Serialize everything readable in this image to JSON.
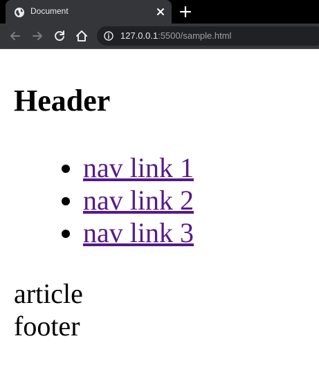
{
  "browser": {
    "tab": {
      "title": "Document",
      "favicon": "globe-icon",
      "close_icon": "close-icon"
    },
    "new_tab_icon": "plus-icon",
    "toolbar": {
      "back_icon": "arrow-left-icon",
      "forward_icon": "arrow-right-icon",
      "reload_icon": "reload-icon",
      "home_icon": "home-icon",
      "info_icon": "info-icon",
      "url_host": "127.0.0.1",
      "url_rest": ":5500/sample.html"
    },
    "colors": {
      "tab_strip": "#000000",
      "toolbar": "#35363a",
      "omnibox": "#202124",
      "visited_link": "#551a8b"
    }
  },
  "page": {
    "header": "Header",
    "nav": {
      "links": [
        "nav link 1",
        "nav link 2",
        "nav link 3"
      ]
    },
    "article": "article",
    "footer": "footer"
  }
}
